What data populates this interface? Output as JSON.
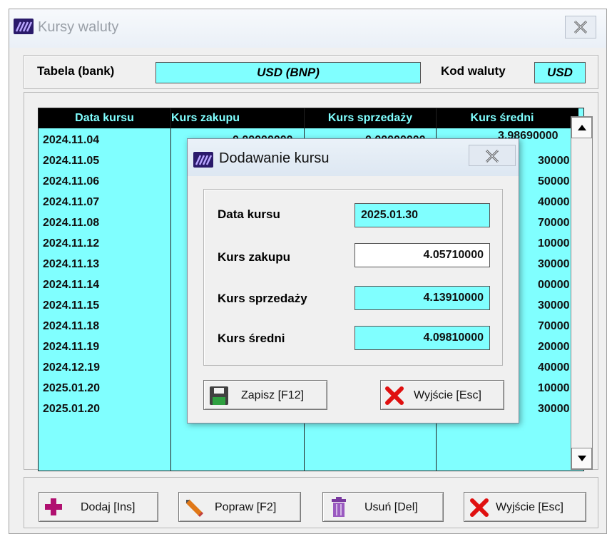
{
  "window": {
    "title": "Kursy waluty"
  },
  "header": {
    "table_label": "Tabela (bank)",
    "table_value": "USD (BNP)",
    "code_label": "Kod waluty",
    "code_value": "USD"
  },
  "grid": {
    "columns": [
      "Data kursu",
      "Kurs zakupu",
      "Kurs sprzedaży",
      "Kurs średni"
    ],
    "first_row_zeros": [
      "0.00000000",
      "0.00000000",
      "3.98690000"
    ],
    "dates": [
      "2024.11.04",
      "2024.11.05",
      "2024.11.06",
      "2024.11.07",
      "2024.11.08",
      "2024.11.12",
      "2024.11.13",
      "2024.11.14",
      "2024.11.15",
      "2024.11.18",
      "2024.11.19",
      "2024.12.19",
      "2025.01.20",
      "2025.01.20"
    ],
    "avg_partial": [
      "30000",
      "50000",
      "40000",
      "70000",
      "10000",
      "30000",
      "00000",
      "30000",
      "70000",
      "20000",
      "40000",
      "10000",
      "30000"
    ]
  },
  "buttons": {
    "add": "Dodaj [Ins]",
    "edit": "Popraw [F2]",
    "delete": "Usuń [Del]",
    "exit": "Wyjście [Esc]"
  },
  "dialog": {
    "title": "Dodawanie kursu",
    "date_label": "Data kursu",
    "date_value": "2025.01.30",
    "buy_label": "Kurs zakupu",
    "buy_value": "4.05710000",
    "sell_label": "Kurs sprzedaży",
    "sell_value": "4.13910000",
    "avg_label": "Kurs średni",
    "avg_value": "4.09810000",
    "save": "Zapisz [F12]",
    "exit": "Wyjście [Esc]"
  }
}
